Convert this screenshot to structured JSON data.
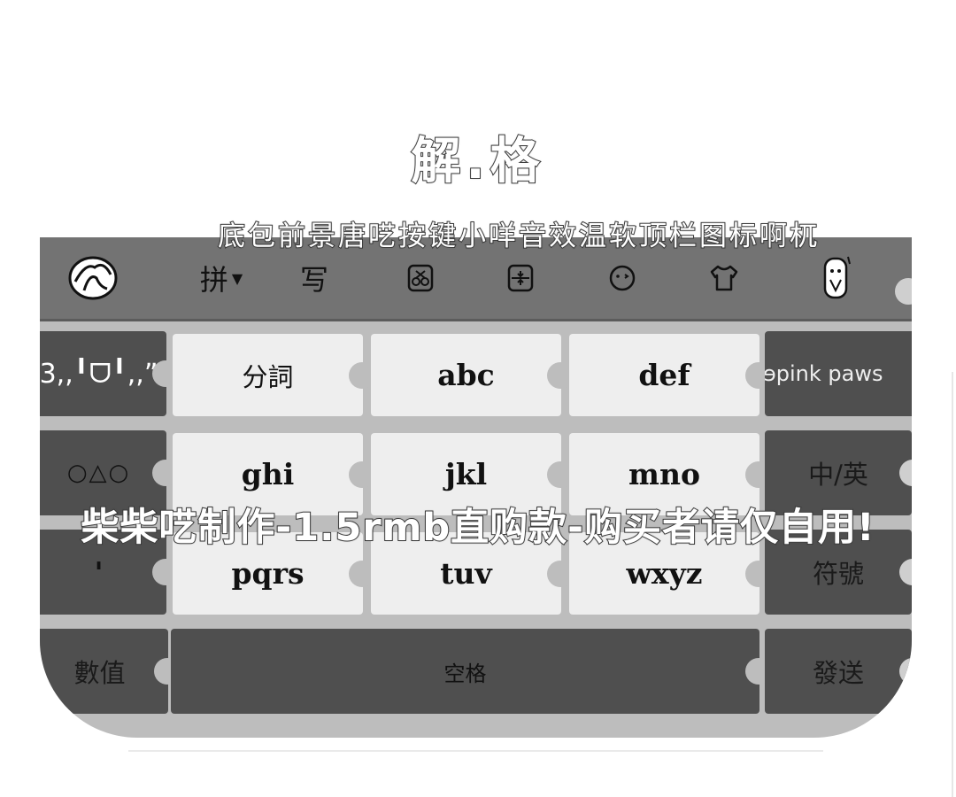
{
  "title": "解.格",
  "subtitle": "底包前景唐呓按键小咩音效温软顶栏图标啊杌",
  "watermark": "柴柴呓制作-1.5rmb直购款-购买者请仅自用!",
  "toolbar": {
    "items": [
      {
        "label": "",
        "icon": "avatar-icon"
      },
      {
        "label": "拼",
        "icon": "caret-down-icon"
      },
      {
        "label": "写",
        "icon": ""
      },
      {
        "label": "",
        "icon": "scissors-icon"
      },
      {
        "label": "",
        "icon": "keyboard-float-icon"
      },
      {
        "label": "",
        "icon": "emoji-wink-icon"
      },
      {
        "label": "",
        "icon": "shirt-icon"
      },
      {
        "label": "",
        "icon": "mascot-icon"
      }
    ]
  },
  "keys": {
    "row1": {
      "left": "3,,╹ᗜ╹,,”",
      "k1": "分詞",
      "k2": "abc",
      "k3": "def",
      "right": "ɘpink paws"
    },
    "row2": {
      "left": "○△○",
      "k1": "ghi",
      "k2": "jkl",
      "k3": "mno",
      "right": "中/英"
    },
    "row3": {
      "left": "'",
      "k1": "pqrs",
      "k2": "tuv",
      "k3": "wxyz",
      "right": "符號"
    },
    "row4": {
      "left": "數值",
      "space": "空格",
      "right": "發送"
    }
  },
  "colors": {
    "toolbar": "#737373",
    "light_key": "#eeeeee",
    "dark_key": "#4f4f4f",
    "board": "#bdbdbd"
  }
}
